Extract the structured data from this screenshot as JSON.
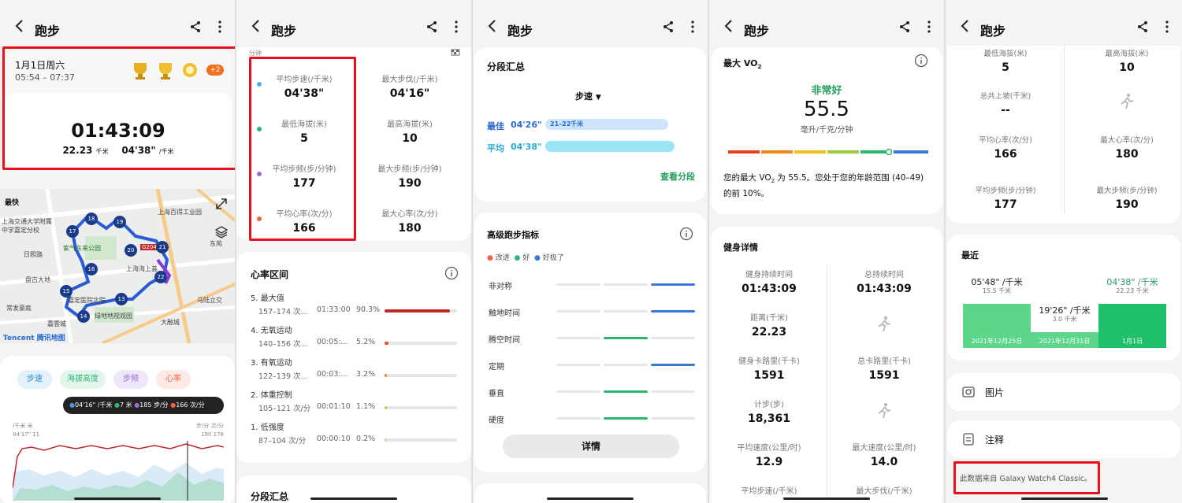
{
  "app": {
    "title": "跑步"
  },
  "p1": {
    "date": "1月1日周六",
    "time_range": "05:54 – 07:37",
    "badge_more": "+2",
    "duration": "01:43:09",
    "distance": "22.23",
    "distance_unit": "千米",
    "pace": "04'38\"",
    "pace_unit": "/千米",
    "map": {
      "fastest_label": "最快",
      "places": [
        "上海交通大学附属中学嘉定分校",
        "日照路",
        "紫气东来公园",
        "盘古大地",
        "常发豪庭",
        "嘉定医院北院",
        "绿地地视观园",
        "嘉雲城",
        "东苑",
        "大融城",
        "马陆立交",
        "上海百得工业园",
        "上海海上荟",
        "G204"
      ],
      "markers": [
        "18",
        "19",
        "17",
        "20",
        "21",
        "22",
        "16",
        "15",
        "13",
        "14"
      ],
      "logo": "Tencent 腾讯地图"
    },
    "chips": [
      "步速",
      "海拔高度",
      "步频",
      "心率"
    ],
    "tooltip": [
      {
        "color": "#4a90e2",
        "text": "04'16\" /千米"
      },
      {
        "color": "#2bb673",
        "text": "7 米"
      },
      {
        "color": "#9b6bd6",
        "text": "185 步/分"
      },
      {
        "color": "#f0623e",
        "text": "166 次/分"
      }
    ],
    "axis_left_unit": "/千米  米",
    "axis_left_val": "04'17\"  11",
    "axis_right_unit": "步/分  次/分",
    "axis_right_val": "190  178",
    "colors": {
      "pace_line": "#c0282a",
      "cadence_fill": "#a9dbc8",
      "alt_fill": "#b9d6f0"
    }
  },
  "p2": {
    "unit_hint": "分钟",
    "metrics_left": [
      {
        "label": "平均步速(/千米)",
        "value": "04'38\"",
        "dot": "#4ab0e8"
      },
      {
        "label": "最低海拔(米)",
        "value": "5",
        "dot": "#2bb673"
      },
      {
        "label": "平均步频(步/分钟)",
        "value": "177",
        "dot": "#9b6bd6"
      },
      {
        "label": "平均心率(次/分)",
        "value": "166",
        "dot": "#f0623e"
      }
    ],
    "metrics_right": [
      {
        "label": "最大步伐(/千米)",
        "value": "04'16\""
      },
      {
        "label": "最高海拔(米)",
        "value": "10"
      },
      {
        "label": "最大步频(步/分钟)",
        "value": "190"
      },
      {
        "label": "最大心率(次/分)",
        "value": "180"
      }
    ],
    "hr_title": "心率区间",
    "zones": [
      {
        "name": "5. 最大值",
        "range": "157–174 次...",
        "time": "01:33:00",
        "pct": "90.3%",
        "frac": 0.903,
        "color": "#c0282a"
      },
      {
        "name": "4. 无氧运动",
        "range": "140–156 次...",
        "time": "00:05:...",
        "pct": "5.2%",
        "frac": 0.052,
        "color": "#e8501c"
      },
      {
        "name": "3. 有氧运动",
        "range": "122–139 次...",
        "time": "00:03:...",
        "pct": "3.2%",
        "frac": 0.032,
        "color": "#f08a1c"
      },
      {
        "name": "2. 体重控制",
        "range": "105–121 次/分",
        "time": "00:01:10",
        "pct": "1.1%",
        "frac": 0.011,
        "color": "#e0c040"
      },
      {
        "name": "1. 低强度",
        "range": "87–104 次/分",
        "time": "00:00:10",
        "pct": "0.2%",
        "frac": 0.002,
        "color": "#c8d8a0"
      }
    ],
    "next_title": "分段汇总"
  },
  "p3": {
    "seg_title": "分段汇总",
    "dropdown": "步速",
    "best_label": "最佳",
    "best_val": "04'26\"",
    "best_range": "21–22千米",
    "avg_label": "平均",
    "avg_val": "04'38\"",
    "view_seg": "查看分段",
    "adv_title": "高级跑步指标",
    "legend": [
      {
        "color": "#f0623e",
        "text": "改进"
      },
      {
        "color": "#2bb673",
        "text": "好"
      },
      {
        "color": "#3a78d8",
        "text": "好极了"
      }
    ],
    "rows": [
      {
        "label": "非对称",
        "level": 2
      },
      {
        "label": "触地时间",
        "level": 2
      },
      {
        "label": "腾空时间",
        "level": 1
      },
      {
        "label": "定期",
        "level": 2
      },
      {
        "label": "垂直",
        "level": 1
      },
      {
        "label": "硬度",
        "level": 1
      }
    ],
    "details": "详情"
  },
  "p4": {
    "vo2_title": "最大 VO",
    "vo2_sub": "2",
    "status": "非常好",
    "value": "55.5",
    "unit": "毫升/千克/分钟",
    "desc_a": "您的最大 VO",
    "desc_sub": "2",
    "desc_b": " 为 55.5。您处于您的年龄范围 (40–49) 的前 10%。",
    "fitness_title": "健身详情",
    "details": [
      {
        "label": "健身持续时间",
        "value": "01:43:09"
      },
      {
        "label": "总持续时间",
        "value": "01:43:09"
      },
      {
        "label": "距离(千米)",
        "value": "22.23"
      },
      {
        "label": "",
        "value": ""
      },
      {
        "label": "健身卡路里(千卡)",
        "value": "1591"
      },
      {
        "label": "总卡路里(千卡)",
        "value": "1591"
      },
      {
        "label": "计步(步)",
        "value": "18,361"
      },
      {
        "label": "",
        "value": ""
      },
      {
        "label": "平均速度(公里/时)",
        "value": "12.9"
      },
      {
        "label": "最大速度(公里/时)",
        "value": "14.0"
      },
      {
        "label": "平均步速(/千米)",
        "value": ""
      },
      {
        "label": "最大步伐(/千米)",
        "value": ""
      }
    ]
  },
  "p5": {
    "top": [
      {
        "label": "最低海拔(米)",
        "value": "5"
      },
      {
        "label": "最高海拔(米)",
        "value": "10"
      },
      {
        "label": "总共上坡(千米)",
        "value": "--"
      },
      {
        "label": "",
        "value": ""
      },
      {
        "label": "平均心率(次/分)",
        "value": "166"
      },
      {
        "label": "最大心率(次/分)",
        "value": "180"
      },
      {
        "label": "平均步频(步/分钟)",
        "value": "177"
      },
      {
        "label": "最大步频(步/分钟)",
        "value": "190"
      }
    ],
    "recent_title": "最近",
    "recent": [
      {
        "pace": "05'48\" /千米",
        "dist": "15.5 千米",
        "date": "2021年12月25日",
        "color": "#5cd68a",
        "frac": 0.7
      },
      {
        "pace": "19'26\" /千米",
        "dist": "3.0 千米",
        "date": "2021年12月31日",
        "color": "#5cd68a",
        "frac": 0.25
      },
      {
        "pace": "04'38\" /千米",
        "dist": "22.23 千米",
        "date": "1月1日",
        "color": "#1fc06a",
        "frac": 0.7
      }
    ],
    "images": "图片",
    "notes": "注释",
    "source": "此数据来自 Galaxy Watch4 Classic。"
  }
}
